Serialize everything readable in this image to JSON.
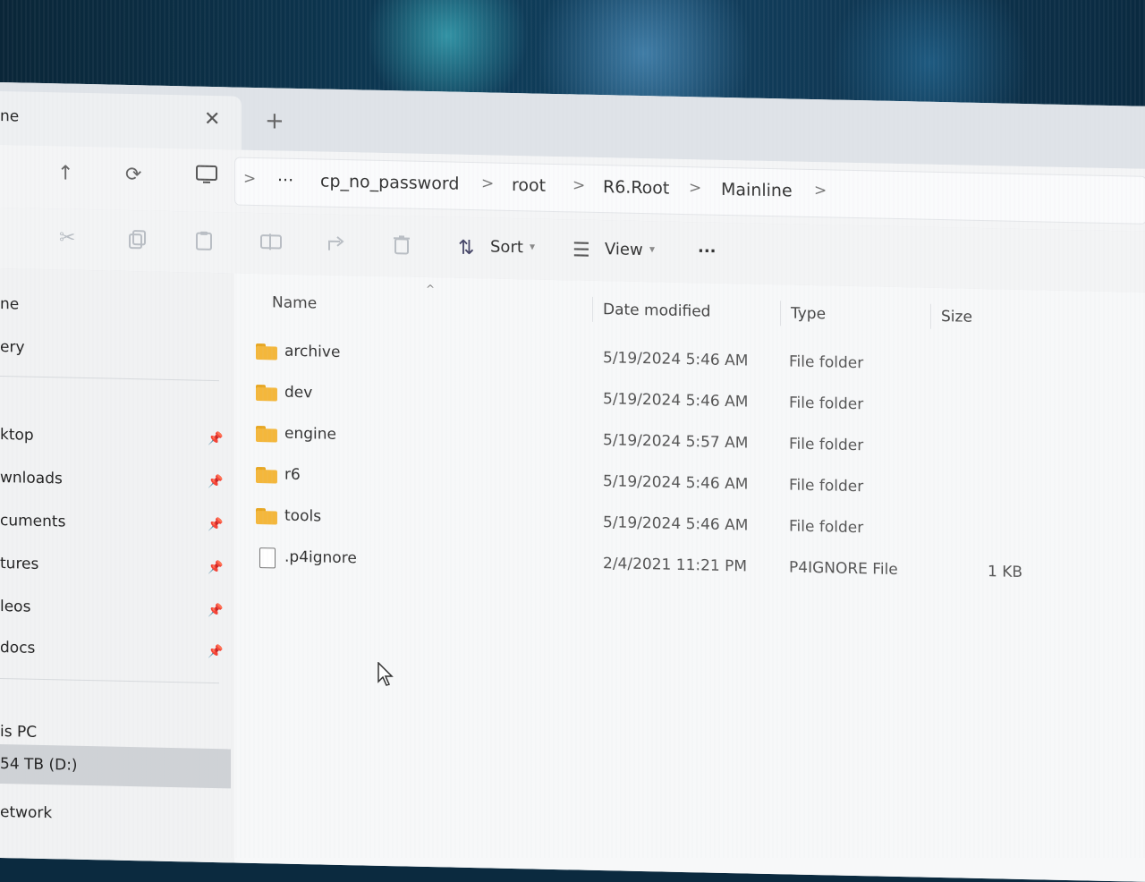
{
  "tab": {
    "title": "ne",
    "close_glyph": "✕",
    "new_tab_glyph": "+"
  },
  "address": {
    "overflow": "···",
    "crumbs": [
      "cp_no_password",
      "root",
      "R6.Root",
      "Mainline"
    ],
    "separator": ">"
  },
  "toolbar": {
    "sort_label": "Sort",
    "view_label": "View",
    "more_label": "···"
  },
  "sidebar": {
    "items_top": [
      "ne",
      "ery"
    ],
    "pinned": [
      "ktop",
      "wnloads",
      "cuments",
      "tures",
      "leos",
      "docs"
    ],
    "drives": [
      "is PC",
      "54 TB (D:)",
      "etwork"
    ]
  },
  "columns": {
    "name": "Name",
    "date": "Date modified",
    "type": "Type",
    "size": "Size"
  },
  "files": [
    {
      "name": "archive",
      "date": "5/19/2024 5:46 AM",
      "type": "File folder",
      "size": "",
      "kind": "folder"
    },
    {
      "name": "dev",
      "date": "5/19/2024 5:46 AM",
      "type": "File folder",
      "size": "",
      "kind": "folder"
    },
    {
      "name": "engine",
      "date": "5/19/2024 5:57 AM",
      "type": "File folder",
      "size": "",
      "kind": "folder"
    },
    {
      "name": "r6",
      "date": "5/19/2024 5:46 AM",
      "type": "File folder",
      "size": "",
      "kind": "folder"
    },
    {
      "name": "tools",
      "date": "5/19/2024 5:46 AM",
      "type": "File folder",
      "size": "",
      "kind": "folder"
    },
    {
      "name": ".p4ignore",
      "date": "2/4/2021 11:21 PM",
      "type": "P4IGNORE File",
      "size": "1 KB",
      "kind": "file"
    }
  ],
  "colors": {
    "folder": "#f4b73b",
    "selected": "#cfd2d6",
    "background": "#f3f4f5"
  }
}
